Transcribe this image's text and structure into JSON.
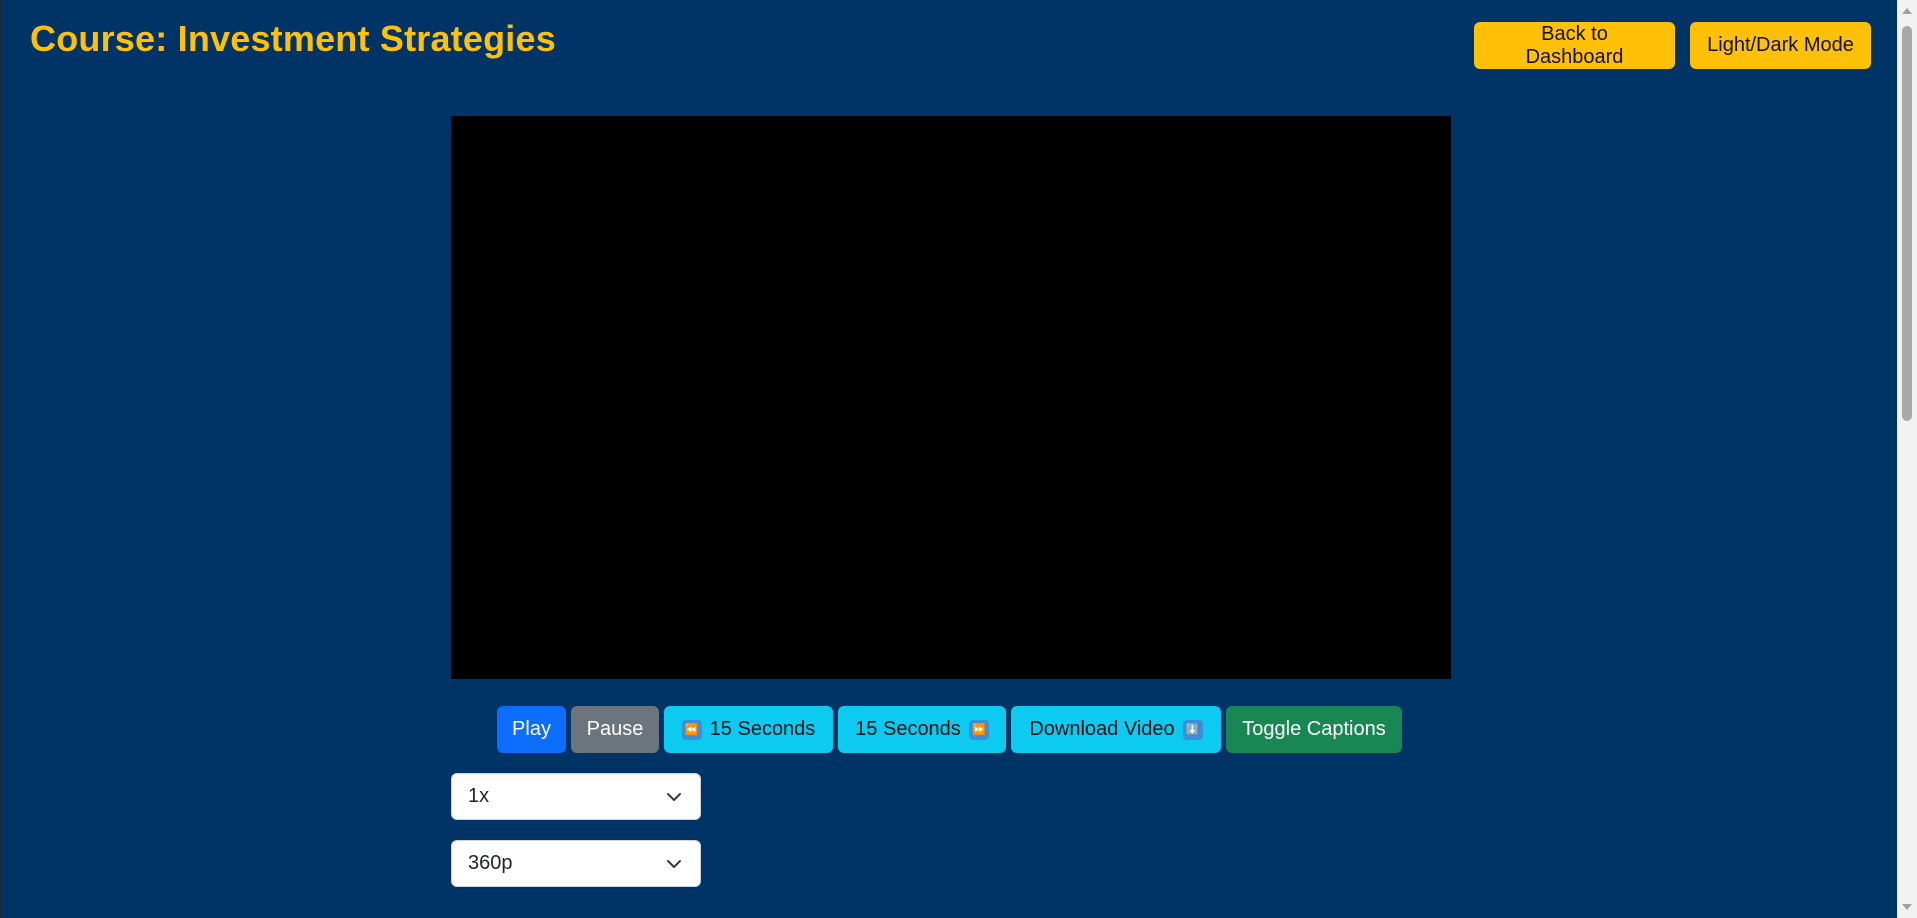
{
  "header": {
    "title": "Course: Investment Strategies",
    "back_label": "Back to Dashboard",
    "mode_label": "Light/Dark Mode"
  },
  "player": {
    "play_label": "Play",
    "pause_label": "Pause",
    "rewind_label": "15 Seconds",
    "forward_label": "15 Seconds",
    "download_label": "Download Video",
    "captions_label": "Toggle Captions",
    "rewind_icon": "⏪",
    "forward_icon": "⏩",
    "download_icon": "⬇️"
  },
  "speed_select": {
    "value": "1x"
  },
  "quality_select": {
    "value": "360p"
  },
  "colors": {
    "background": "#003366",
    "accent": "#ffc107",
    "primary": "#0d6efd",
    "secondary": "#6c757d",
    "info": "#0dcaf0",
    "success": "#198754"
  }
}
